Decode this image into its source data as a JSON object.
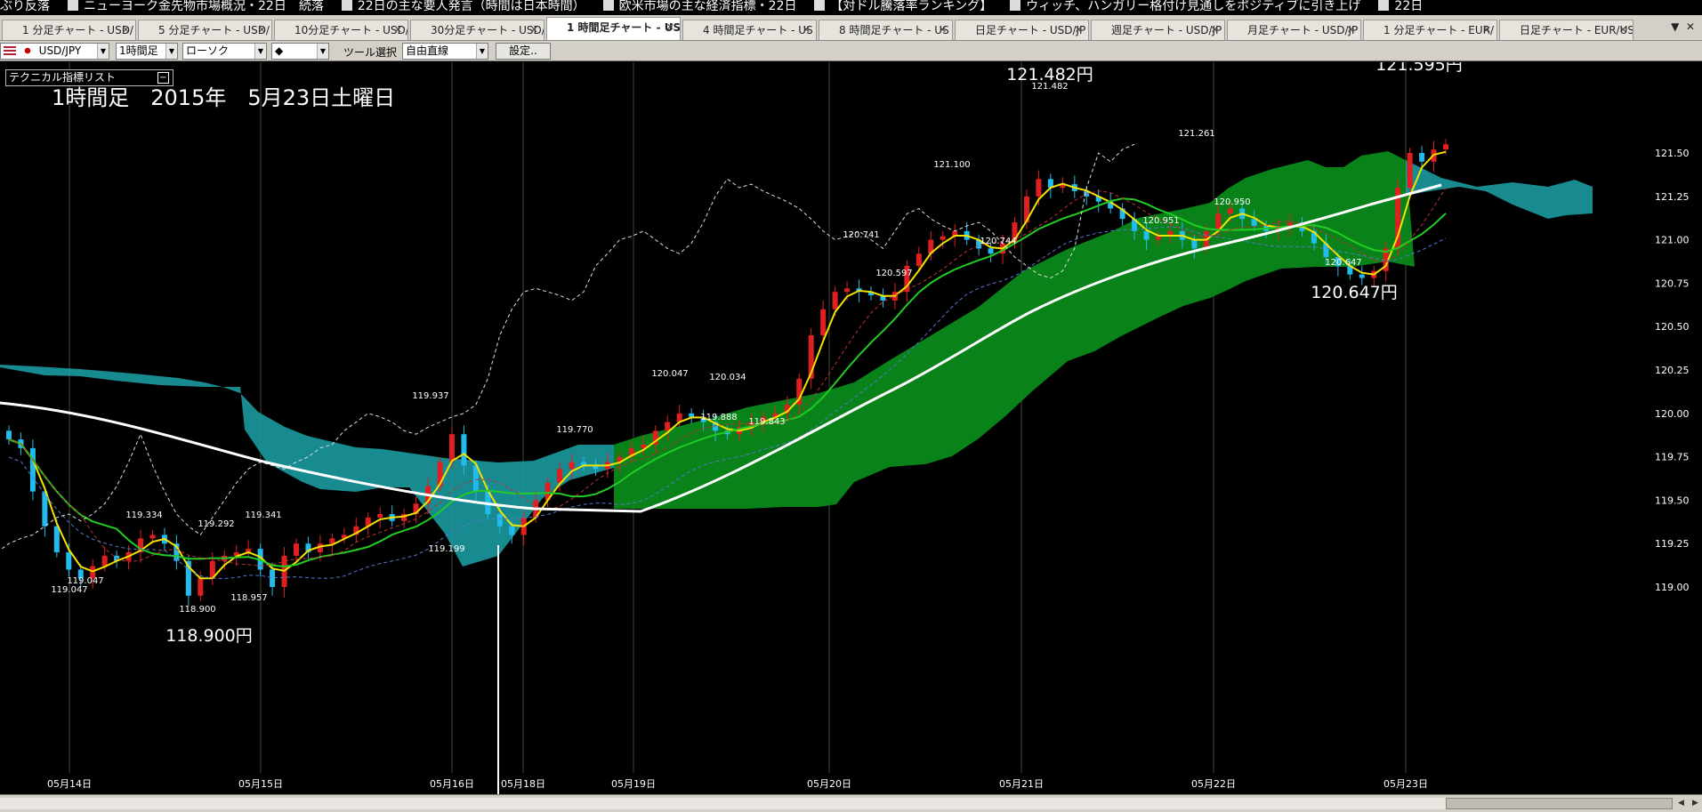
{
  "ticker": {
    "items": [
      "ぶり反落",
      "ニューヨーク金先物市場概況・22日　続落",
      "22日の主な要人発言（時間は日本時間）",
      "欧米市場の主な経済指標・22日",
      "【対ドル騰落率ランキング】",
      "ウィッチ、ハンガリー格付け見通しをポジティブに引き上げ",
      "22日"
    ]
  },
  "tabs": [
    {
      "label": "1 分足チャート - USD/",
      "active": false
    },
    {
      "label": "5 分足チャート - USD/",
      "active": false
    },
    {
      "label": "10分足チャート - USD/",
      "active": false
    },
    {
      "label": "30分足チャート - USD/",
      "active": false
    },
    {
      "label": "1 時間足チャート - US",
      "active": true
    },
    {
      "label": "4 時間足チャート - US",
      "active": false
    },
    {
      "label": "8 時間足チャート - US",
      "active": false
    },
    {
      "label": "日足チャート - USD/JP",
      "active": false
    },
    {
      "label": "週足チャート - USD/JP",
      "active": false
    },
    {
      "label": "月足チャート - USD/JP",
      "active": false
    },
    {
      "label": "1 分足チャート - EUR/",
      "active": false
    },
    {
      "label": "日足チャート - EUR/US",
      "active": false
    }
  ],
  "toolbar": {
    "pair": "USD/JPY",
    "timeframe": "1時間足",
    "chart_style": "ローソク",
    "marker": "◆",
    "tool_label": "ツール選択",
    "tool_value": "自由直線",
    "settings_button": "設定.."
  },
  "indicator_list": {
    "label": "テクニカル指標リスト"
  },
  "chart_data": {
    "type": "candlestick",
    "heading": "1時間足　2015年　5月23日土曜日",
    "y_ticks": [
      "121.50",
      "121.25",
      "121.00",
      "120.75",
      "120.50",
      "120.25",
      "120.00",
      "119.75",
      "119.50",
      "119.25",
      "119.00"
    ],
    "x_ticks": [
      "05月14日",
      "05月15日",
      "05月16日",
      "05月18日",
      "05月19日",
      "05月20日",
      "05月21日",
      "05月22日",
      "05月23日"
    ],
    "ylim": [
      118.8,
      121.75
    ],
    "big_annotations": [
      "121.482円",
      "121.595円",
      "120.647円",
      "118.900円"
    ],
    "annotations": [
      {
        "text": "121.482",
        "value": 121.482
      },
      {
        "text": "121.261",
        "value": 121.261
      },
      {
        "text": "121.100",
        "value": 121.1
      },
      {
        "text": "120.950",
        "value": 120.95
      },
      {
        "text": "120.951",
        "value": 120.951
      },
      {
        "text": "120.744",
        "value": 120.744
      },
      {
        "text": "120.741",
        "value": 120.741
      },
      {
        "text": "120.597",
        "value": 120.597
      },
      {
        "text": "120.647",
        "value": 120.647
      },
      {
        "text": "120.047",
        "value": 120.047
      },
      {
        "text": "120.034",
        "value": 120.034
      },
      {
        "text": "119.888",
        "value": 119.888
      },
      {
        "text": "119.843",
        "value": 119.843
      },
      {
        "text": "119.937",
        "value": 119.937
      },
      {
        "text": "119.770",
        "value": 119.77
      },
      {
        "text": "119.334",
        "value": 119.334
      },
      {
        "text": "119.341",
        "value": 119.341
      },
      {
        "text": "119.292",
        "value": 119.292
      },
      {
        "text": "119.199",
        "value": 119.199
      },
      {
        "text": "119.047",
        "value": 119.047
      },
      {
        "text": "119.047",
        "value": 119.047
      },
      {
        "text": "118.957",
        "value": 118.957
      },
      {
        "text": "118.900",
        "value": 118.9
      }
    ],
    "series": [
      {
        "name": "close",
        "values": [
          119.85,
          119.8,
          119.55,
          119.35,
          119.2,
          119.1,
          119.05,
          119.12,
          119.18,
          119.15,
          119.2,
          119.28,
          119.3,
          119.25,
          119.15,
          118.95,
          119.05,
          119.15,
          119.18,
          119.2,
          119.22,
          119.1,
          119.0,
          119.18,
          119.25,
          119.2,
          119.25,
          119.28,
          119.3,
          119.35,
          119.4,
          119.42,
          119.38,
          119.42,
          119.48,
          119.58,
          119.72,
          119.88,
          119.7,
          119.55,
          119.42,
          119.35,
          119.3,
          119.4,
          119.5,
          119.6,
          119.68,
          119.72,
          119.7,
          119.68,
          119.72,
          119.75,
          119.8,
          119.82,
          119.9,
          119.95,
          120.0,
          119.98,
          119.95,
          119.9,
          119.88,
          119.92,
          119.95,
          119.98,
          120.0,
          120.05,
          120.2,
          120.45,
          120.6,
          120.7,
          120.72,
          120.7,
          120.68,
          120.65,
          120.7,
          120.85,
          120.92,
          121.0,
          121.02,
          121.05,
          121.0,
          120.95,
          120.92,
          120.98,
          121.1,
          121.25,
          121.35,
          121.3,
          121.32,
          121.28,
          121.25,
          121.22,
          121.18,
          121.12,
          121.05,
          121.0,
          121.02,
          121.05,
          121.0,
          120.95,
          121.05,
          121.15,
          121.18,
          121.12,
          121.08,
          121.05,
          121.08,
          121.1,
          121.05,
          120.98,
          120.9,
          120.85,
          120.8,
          120.78,
          120.82,
          120.95,
          121.3,
          121.5,
          121.45,
          121.52,
          121.55
        ]
      }
    ],
    "annotation_pixels": []
  }
}
